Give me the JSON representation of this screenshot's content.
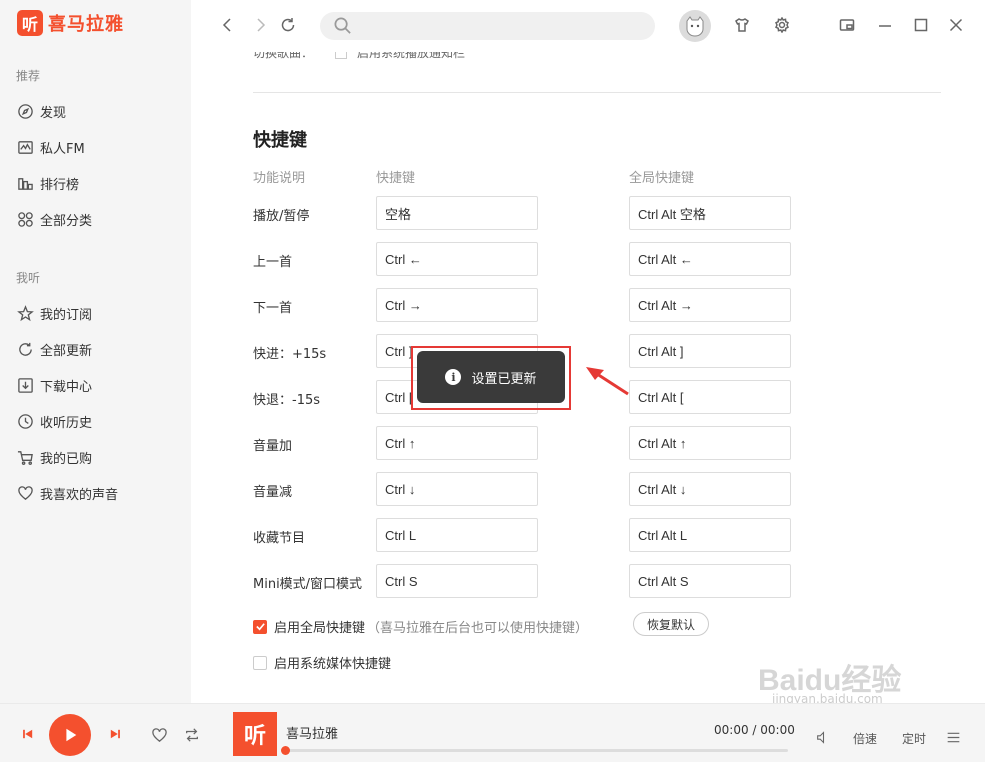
{
  "app": {
    "logo_glyph": "听",
    "name": "喜马拉雅",
    "accent_color": "#f4502e"
  },
  "sidebar": {
    "recommend_title": "推荐",
    "recommend_items": [
      {
        "label": "发现",
        "icon": "compass-icon"
      },
      {
        "label": "私人FM",
        "icon": "radio-wave-icon"
      },
      {
        "label": "排行榜",
        "icon": "ranking-bars-icon"
      },
      {
        "label": "全部分类",
        "icon": "category-grid-icon"
      }
    ],
    "mine_title": "我听",
    "mine_items": [
      {
        "label": "我的订阅",
        "icon": "star-icon"
      },
      {
        "label": "全部更新",
        "icon": "refresh-icon"
      },
      {
        "label": "下载中心",
        "icon": "download-icon"
      },
      {
        "label": "收听历史",
        "icon": "clock-icon"
      },
      {
        "label": "我的已购",
        "icon": "cart-icon"
      },
      {
        "label": "我喜欢的声音",
        "icon": "heart-icon"
      }
    ]
  },
  "topbar": {
    "search_placeholder": ""
  },
  "settings": {
    "cut_label": "切换歌曲：",
    "cut_option": "启用系统播放通知栏",
    "heading": "快捷键",
    "col_function": "功能说明",
    "col_shortcut": "快捷键",
    "col_global": "全局快捷键",
    "rows": [
      {
        "label": "播放/暂停",
        "shortcut": "空格",
        "global": "Ctrl Alt 空格"
      },
      {
        "label": "上一首",
        "shortcut": "Ctrl ←",
        "global": "Ctrl Alt ←"
      },
      {
        "label": "下一首",
        "shortcut": "Ctrl →",
        "global": "Ctrl Alt →"
      },
      {
        "label": "快进：+15s",
        "shortcut": "Ctrl ]",
        "global": "Ctrl Alt ]"
      },
      {
        "label": "快退：-15s",
        "shortcut": "Ctrl [",
        "global": "Ctrl Alt ["
      },
      {
        "label": "音量加",
        "shortcut": "Ctrl ↑",
        "global": "Ctrl Alt ↑"
      },
      {
        "label": "音量减",
        "shortcut": "Ctrl ↓",
        "global": "Ctrl Alt ↓"
      },
      {
        "label": "收藏节目",
        "shortcut": "Ctrl L",
        "global": "Ctrl Alt L"
      },
      {
        "label": "Mini模式/窗口模式",
        "shortcut": "Ctrl S",
        "global": "Ctrl Alt S"
      }
    ],
    "global_enable_label": "启用全局快捷键",
    "global_enable_hint": "（喜马拉雅在后台也可以使用快捷键）",
    "global_enable_checked": true,
    "media_enable_label": "启用系统媒体快捷键",
    "media_enable_checked": false,
    "restore_label": "恢复默认"
  },
  "toast": {
    "message": "设置已更新",
    "info_glyph": "i"
  },
  "player": {
    "cover_glyph": "听",
    "track_title": "喜马拉雅",
    "time": "00:00 / 00:00",
    "progress": 0,
    "speed_label": "倍速",
    "timer_label": "定时"
  },
  "watermark": {
    "text": "Baidu经验",
    "sub": "jingyan.baidu.com"
  }
}
